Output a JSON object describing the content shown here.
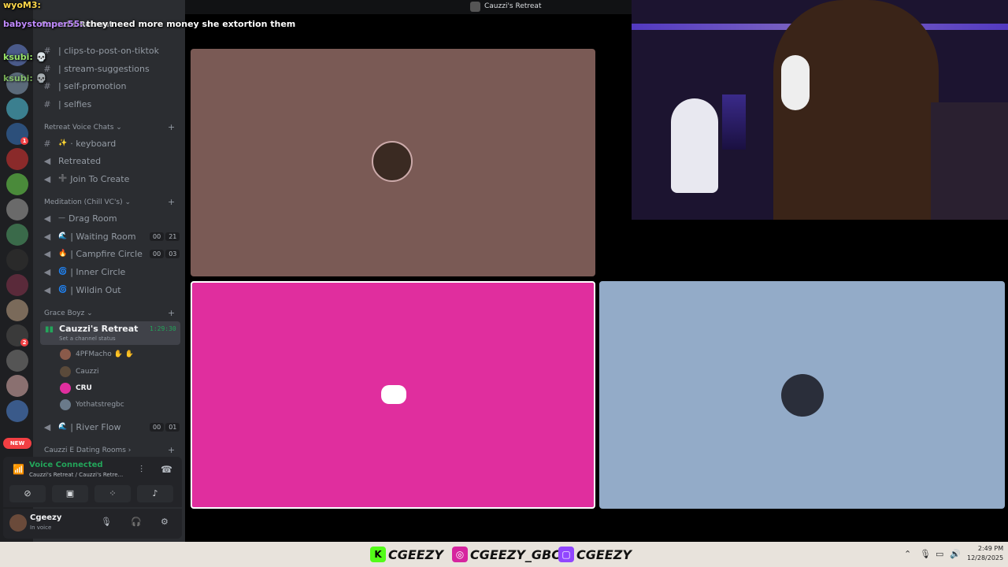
{
  "window": {
    "title": "Cauzzi's Retreat"
  },
  "server": {
    "name": "Cauzzi's Retreat"
  },
  "chat_overlay": [
    {
      "user": "wyoM3:",
      "text": ""
    },
    {
      "user": "babystomper55:",
      "text": "they need more money she extortion them"
    },
    {
      "user": "ksubi:",
      "text": "💀"
    },
    {
      "user": "ksubi:",
      "text": "💀"
    }
  ],
  "channels_top": [
    {
      "name": "| clips-to-post-on-tiktok"
    },
    {
      "name": "| stream-suggestions"
    },
    {
      "name": "| self-promotion"
    },
    {
      "name": "| selfies"
    }
  ],
  "cat_retreat_voice": "Retreat Voice Chats",
  "retreat_voice": [
    {
      "name": "· keyboard",
      "emoji": "✨"
    },
    {
      "name": "Retreated",
      "emoji": ""
    },
    {
      "name": "Join To Create",
      "emoji": "➕"
    }
  ],
  "cat_meditation": "Meditation (Chill VC's)",
  "meditation": [
    {
      "name": "Drag Room",
      "emoji": "—",
      "counts": []
    },
    {
      "name": "| Waiting Room",
      "emoji": "🌊",
      "counts": [
        "00",
        "21"
      ]
    },
    {
      "name": "| Campfire Circle",
      "emoji": "🔥",
      "counts": [
        "00",
        "03"
      ]
    },
    {
      "name": "| Inner Circle",
      "emoji": "🌀",
      "counts": []
    },
    {
      "name": "| Wildin Out",
      "emoji": "🌀",
      "counts": []
    }
  ],
  "cat_grace": "Grace Boyz",
  "active_channel": {
    "name": "Cauzzi's Retreat",
    "status": "Set a channel status",
    "time": "1:29:30"
  },
  "members": [
    {
      "name": "4PFMacho ✋ ✋"
    },
    {
      "name": "Cauzzi"
    },
    {
      "name": "CRU"
    },
    {
      "name": "Yothatstregbc"
    }
  ],
  "river_flow": {
    "name": "| River Flow",
    "counts": [
      "00",
      "01"
    ]
  },
  "cat_dating": "Cauzzi E Dating Rooms",
  "voice_panel": {
    "status": "Voice Connected",
    "location": "Cauzzi's Retreat / Cauzzi's Retre..."
  },
  "user_panel": {
    "name": "Cgeezy",
    "status": "In voice"
  },
  "rail": {
    "new_label": "NEW",
    "badges": [
      "1",
      "2"
    ]
  },
  "taskbar": {
    "tags": [
      "CGEEZY",
      "CGEEZY_GBC",
      "CGEEZY"
    ],
    "time": "2:49 PM",
    "date": "12/28/2025"
  },
  "colors": {
    "tile_top": "#7a5a55",
    "tile_pink": "#e02e9e",
    "tile_blue": "#93abc8",
    "green": "#23a55a",
    "red": "#f23f43"
  }
}
